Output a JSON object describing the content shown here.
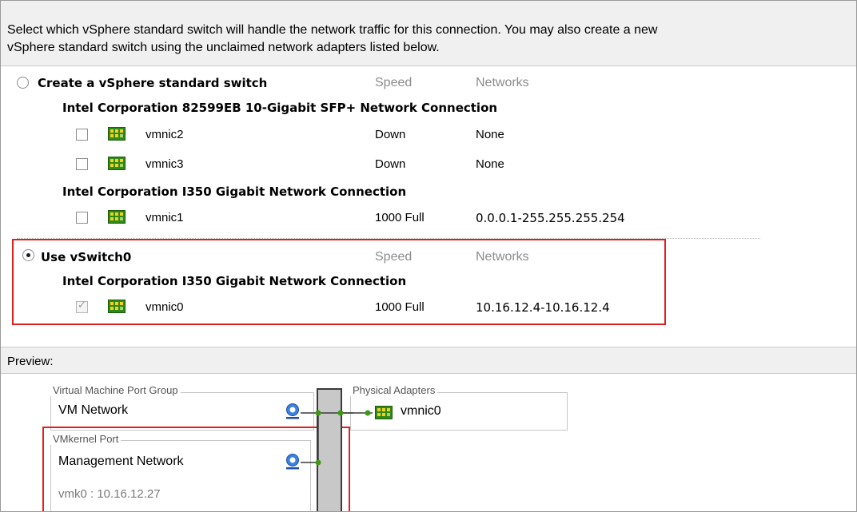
{
  "description": {
    "line1": "Select which vSphere standard switch will handle the network traffic for this connection. You may also create a new",
    "line2": "vSphere standard switch using the unclaimed network adapters listed below."
  },
  "create_switch": {
    "label": "Create a vSphere standard switch",
    "selected": false,
    "speed_header": "Speed",
    "networks_header": "Networks",
    "adapter_groups": [
      {
        "name": "Intel Corporation 82599EB 10-Gigabit SFP+ Network Connection",
        "nics": [
          {
            "name": "vmnic2",
            "speed": "Down",
            "networks": "None",
            "checked": false
          },
          {
            "name": "vmnic3",
            "speed": "Down",
            "networks": "None",
            "checked": false
          }
        ]
      },
      {
        "name": "Intel Corporation I350 Gigabit Network Connection",
        "nics": [
          {
            "name": "vmnic1",
            "speed": "1000 Full",
            "networks": "0.0.0.1-255.255.255.254",
            "checked": false
          }
        ]
      }
    ]
  },
  "use_switch": {
    "label": "Use vSwitch0",
    "selected": true,
    "speed_header": "Speed",
    "networks_header": "Networks",
    "adapter_group": "Intel Corporation I350 Gigabit Network Connection",
    "nic": {
      "name": "vmnic0",
      "speed": "1000 Full",
      "networks": "10.16.12.4-10.16.12.4",
      "checked": true,
      "disabled": true
    }
  },
  "preview": {
    "label": "Preview:",
    "vm_port_group": {
      "legend": "Virtual Machine Port Group",
      "name": "VM Network"
    },
    "vmkernel_port": {
      "legend": "VMkernel Port",
      "name": "Management Network",
      "address": "vmk0 : 10.16.12.27"
    },
    "physical_adapters": {
      "legend": "Physical Adapters",
      "nic": "vmnic0"
    }
  },
  "colors": {
    "highlight": "#e02020",
    "nic_green": "#3a9a1e",
    "nic_yellow": "#f2d21e",
    "port_blue": "#2a6fd6",
    "link_green": "#3c9a12"
  },
  "icons": {
    "nic": "network-adapter-icon",
    "port": "network-port-icon"
  }
}
